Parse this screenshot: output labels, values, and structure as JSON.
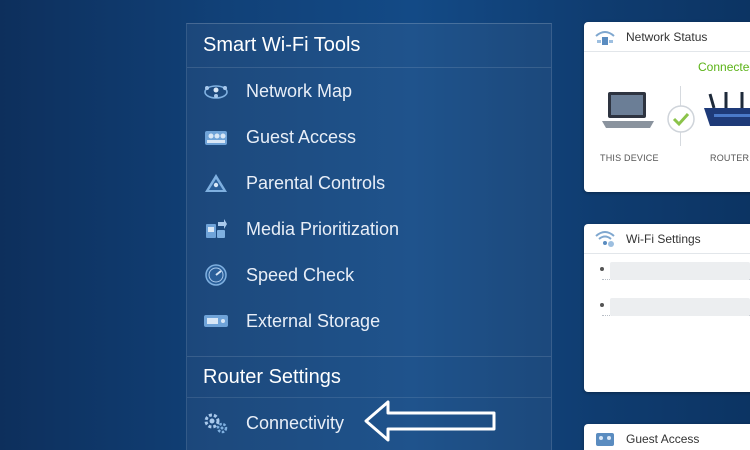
{
  "menu": {
    "header": "Smart Wi-Fi Tools",
    "items": [
      {
        "label": "Network Map",
        "icon": "network-map-icon"
      },
      {
        "label": "Guest Access",
        "icon": "guest-access-icon"
      },
      {
        "label": "Parental Controls",
        "icon": "parental-controls-icon"
      },
      {
        "label": "Media Prioritization",
        "icon": "media-prioritization-icon"
      },
      {
        "label": "Speed Check",
        "icon": "speed-check-icon"
      },
      {
        "label": "External Storage",
        "icon": "external-storage-icon"
      }
    ],
    "section2_header": "Router Settings",
    "connectivity_label": "Connectivity"
  },
  "cards": {
    "network_status": {
      "title": "Network Status",
      "status": "Connected",
      "this_device": "THIS DEVICE",
      "router": "ROUTER"
    },
    "wifi_settings": {
      "title": "Wi-Fi Settings"
    },
    "guest_access": {
      "title": "Guest Access"
    }
  },
  "colors": {
    "background": "#114178",
    "connected_green": "#5bb317",
    "icon_blue": "#7fb0e0"
  }
}
